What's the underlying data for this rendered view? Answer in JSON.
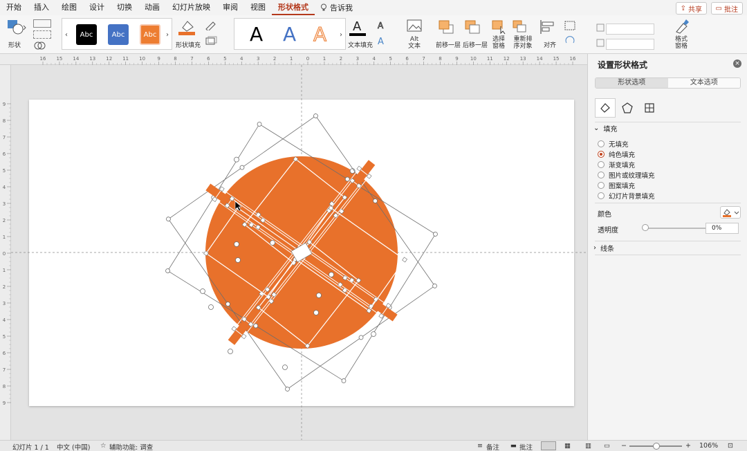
{
  "menu": {
    "tabs": [
      "开始",
      "插入",
      "绘图",
      "设计",
      "切换",
      "动画",
      "幻灯片放映",
      "审阅",
      "视图",
      "形状格式"
    ],
    "active_tab": "形状格式",
    "tell_me": "告诉我",
    "share": "共享",
    "comments": "批注"
  },
  "ribbon": {
    "shapes_label": "形状",
    "style_thumbs": [
      "Abc",
      "Abc",
      "Abc"
    ],
    "shape_fill_label": "形状填充",
    "wordart_letters": [
      "A",
      "A",
      "A"
    ],
    "text_fill_label": "文本填充",
    "alt_text_label": "Alt 文本",
    "bring_forward": "前移一层",
    "send_backward": "后移一层",
    "selection_pane": "选择窗格",
    "reorder": "重新排序对象",
    "align": "对齐",
    "format_pane": "格式窗格"
  },
  "ruler": {
    "h_labels": [
      "16",
      "15",
      "14",
      "13",
      "12",
      "11",
      "10",
      "9",
      "8",
      "7",
      "6",
      "5",
      "4",
      "3",
      "2",
      "1",
      "0",
      "1",
      "2",
      "3",
      "4",
      "5",
      "6",
      "7",
      "8",
      "9",
      "10",
      "11",
      "12",
      "13",
      "14",
      "15",
      "16"
    ],
    "v_labels": [
      "9",
      "8",
      "7",
      "6",
      "5",
      "4",
      "3",
      "2",
      "1",
      "0",
      "1",
      "2",
      "3",
      "4",
      "5",
      "6",
      "7",
      "8",
      "9"
    ]
  },
  "shape": {
    "fill": "#e8712b",
    "handle_stroke": "#6e6e6e"
  },
  "pane": {
    "title": "设置形状格式",
    "tabs": [
      "形状选项",
      "文本选项"
    ],
    "fill_section": "填充",
    "fill_options": [
      "无填充",
      "纯色填充",
      "渐变填充",
      "图片或纹理填充",
      "图案填充",
      "幻灯片背景填充"
    ],
    "selected_fill": "纯色填充",
    "color_label": "颜色",
    "opacity_label": "透明度",
    "opacity_value": "0%",
    "line_section": "线条",
    "accent": "#c0431e"
  },
  "status": {
    "slide": "幻灯片 1 / 1",
    "language": "中文 (中国)",
    "accessibility": "辅助功能: 调查",
    "notes": "备注",
    "comments": "批注",
    "zoom": "106%"
  }
}
